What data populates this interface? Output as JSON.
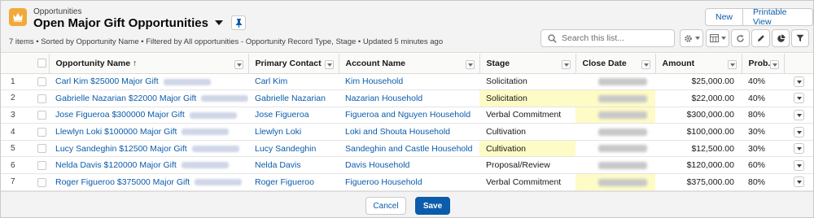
{
  "colors": {
    "brand": "#0b5cab",
    "logo": "#f2a93b",
    "highlight": "#fdfbc6"
  },
  "header": {
    "object_label": "Opportunities",
    "title": "Open Major Gift Opportunities",
    "logo_icon": "crown-icon",
    "meta": "7 items • Sorted by Opportunity Name • Filtered by All opportunities - Opportunity Record Type, Stage • Updated 5 minutes ago",
    "new_label": "New",
    "printable_label": "Printable View",
    "search_placeholder": "Search this list..."
  },
  "toolbar_icons": [
    "gear-icon",
    "table-icon",
    "refresh-icon",
    "pencil-icon",
    "pie-chart-icon",
    "filter-icon"
  ],
  "table": {
    "columns": {
      "name": "Opportunity Name ↑",
      "contact": "Primary Contact",
      "account": "Account Name",
      "stage": "Stage",
      "close": "Close Date",
      "amount": "Amount",
      "prob": "Prob..."
    },
    "rows": [
      {
        "num": "1",
        "name": "Carl Kim $25000 Major Gift",
        "contact": "Carl Kim",
        "account": "Kim Household",
        "stage": "Solicitation",
        "amount": "$25,000.00",
        "prob": "40%",
        "hl_stage": false,
        "hl_date": false
      },
      {
        "num": "2",
        "name": "Gabrielle Nazarian $22000 Major Gift",
        "contact": "Gabrielle Nazarian",
        "account": "Nazarian Household",
        "stage": "Solicitation",
        "amount": "$22,000.00",
        "prob": "40%",
        "hl_stage": true,
        "hl_date": true
      },
      {
        "num": "3",
        "name": "Jose Figueroa $300000 Major Gift",
        "contact": "Jose Figueroa",
        "account": "Figueroa and Nguyen Household",
        "stage": "Verbal Commitment",
        "amount": "$300,000.00",
        "prob": "80%",
        "hl_stage": false,
        "hl_date": true
      },
      {
        "num": "4",
        "name": "Llewlyn Loki $100000 Major Gift",
        "contact": "Llewlyn Loki",
        "account": "Loki and Shouta Household",
        "stage": "Cultivation",
        "amount": "$100,000.00",
        "prob": "30%",
        "hl_stage": false,
        "hl_date": false
      },
      {
        "num": "5",
        "name": "Lucy Sandeghin $12500 Major Gift",
        "contact": "Lucy Sandeghin",
        "account": "Sandeghin and Castle Household",
        "stage": "Cultivation",
        "amount": "$12,500.00",
        "prob": "30%",
        "hl_stage": true,
        "hl_date": false
      },
      {
        "num": "6",
        "name": "Nelda Davis $120000 Major Gift",
        "contact": "Nelda Davis",
        "account": "Davis Household",
        "stage": "Proposal/Review",
        "amount": "$120,000.00",
        "prob": "60%",
        "hl_stage": false,
        "hl_date": false
      },
      {
        "num": "7",
        "name": "Roger Figueroo $375000 Major Gift",
        "contact": "Roger Figueroo",
        "account": "Figueroo Household",
        "stage": "Verbal Commitment",
        "amount": "$375,000.00",
        "prob": "80%",
        "hl_stage": false,
        "hl_date": true
      }
    ]
  },
  "footer": {
    "cancel_label": "Cancel",
    "save_label": "Save"
  }
}
